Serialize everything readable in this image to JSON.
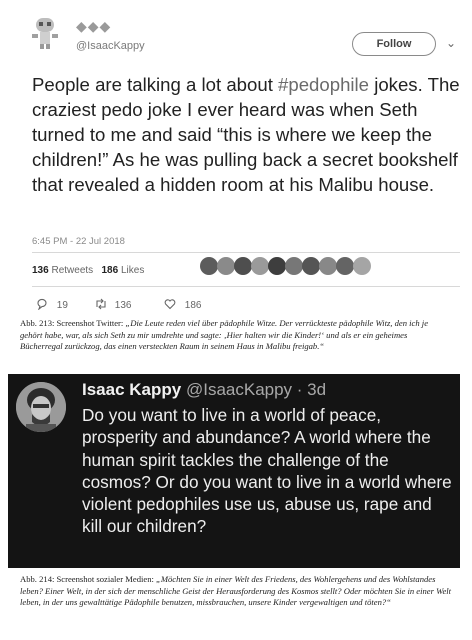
{
  "tweet1": {
    "handle": "@IsaacKappy",
    "follow_label": "Follow",
    "text_before": "People are talking a lot about ",
    "hashtag": "#pedophile",
    "text_after": " jokes. The craziest pedo joke I ever heard was when Seth turned to me and said “this is where we keep the children!” As he was pulling back a secret bookshelf that revealed a hidden room at his Malibu house.",
    "timestamp": "6:45 PM - 22 Jul 2018",
    "retweets_count": "136",
    "retweets_label": "Retweets",
    "likes_count": "186",
    "likes_label": "Likes",
    "reply_count": "19",
    "retweet_action_count": "136",
    "like_action_count": "186"
  },
  "caption1": {
    "prefix": "Abb. 213: Screenshot Twitter: ",
    "text": "„Die Leute reden viel über pädophile Witze. Der verrückteste pädophile Witz, den ich je gehört habe, war, als sich Seth zu mir umdrehte und sagte: ‚Hier halten wir die Kinder!‘ und als er ein geheimes Bücherregal zurückzog, das einen versteckten Raum in seinem Haus in Malibu freigab.“"
  },
  "tweet2": {
    "name": "Isaac Kappy",
    "handle_time": "@IsaacKappy · 3d",
    "text": "Do you want to live in a world of peace, prosperity and abundance? A world where the human spirit tackles the challenge of the cosmos? Or do you want to live in a world where violent pedophiles use us, abuse us, rape and kill our children?"
  },
  "caption2": {
    "prefix": "Abb. 214: Screenshot sozialer Medien: ",
    "text": "„Möchten Sie in einer Welt des Friedens, des Wohlergehens und des Wohlstandes leben? Einer Welt, in der sich der menschliche Geist der Herausforderung des Kosmos stellt? Oder möchten Sie in einer Welt leben, in der uns gewalttätige Pädophile benutzen, missbrauchen, unsere Kinder vergewaltigen und töten?“"
  }
}
